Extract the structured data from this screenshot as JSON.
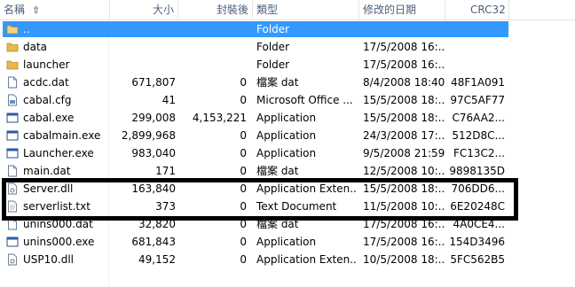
{
  "columns": {
    "name": "名稱",
    "size": "大小",
    "packed": "封裝後",
    "type": "類型",
    "modified": "修改的日期",
    "crc": "CRC32"
  },
  "rows": [
    {
      "name": "..",
      "size": "",
      "packed": "",
      "type": "Folder",
      "date": "",
      "crc": "",
      "icon": "folder-up-icon",
      "selected": true
    },
    {
      "name": "data",
      "size": "",
      "packed": "",
      "type": "Folder",
      "date": "17/5/2008 16:...",
      "crc": "",
      "icon": "folder-icon"
    },
    {
      "name": "launcher",
      "size": "",
      "packed": "",
      "type": "Folder",
      "date": "17/5/2008 16:...",
      "crc": "",
      "icon": "folder-icon"
    },
    {
      "name": "acdc.dat",
      "size": "671,807",
      "packed": "0",
      "type": "檔案 dat",
      "date": "8/4/2008 18:40",
      "crc": "48F1A091",
      "icon": "file-icon"
    },
    {
      "name": "cabal.cfg",
      "size": "41",
      "packed": "0",
      "type": "Microsoft Office ...",
      "date": "15/5/2008 18:...",
      "crc": "97C5AF77",
      "icon": "config-file-icon"
    },
    {
      "name": "cabal.exe",
      "size": "299,008",
      "packed": "4,153,221",
      "type": "Application",
      "date": "15/5/2008 18:...",
      "crc": "C76AA2...",
      "icon": "exe-icon"
    },
    {
      "name": "cabalmain.exe",
      "size": "2,899,968",
      "packed": "0",
      "type": "Application",
      "date": "24/3/2008 17:...",
      "crc": "512D8C...",
      "icon": "exe-icon"
    },
    {
      "name": "Launcher.exe",
      "size": "983,040",
      "packed": "0",
      "type": "Application",
      "date": "9/5/2008 21:59",
      "crc": "FC13C2...",
      "icon": "exe-icon"
    },
    {
      "name": "main.dat",
      "size": "171",
      "packed": "0",
      "type": "檔案 dat",
      "date": "12/5/2008 10:...",
      "crc": "9898135D",
      "icon": "file-icon"
    },
    {
      "name": "Server.dll",
      "size": "163,840",
      "packed": "0",
      "type": "Application Exten...",
      "date": "15/5/2008 18:...",
      "crc": "706DD6...",
      "icon": "dll-icon"
    },
    {
      "name": "serverlist.txt",
      "size": "373",
      "packed": "0",
      "type": "Text Document",
      "date": "11/5/2008 10:...",
      "crc": "6E20248C",
      "icon": "text-file-icon"
    },
    {
      "name": "unins000.dat",
      "size": "32,820",
      "packed": "0",
      "type": "檔案 dat",
      "date": "17/5/2008 16:...",
      "crc": "4A0CE4...",
      "icon": "file-icon"
    },
    {
      "name": "unins000.exe",
      "size": "681,843",
      "packed": "0",
      "type": "Application",
      "date": "17/5/2008 16:...",
      "crc": "154D3496",
      "icon": "exe-icon"
    },
    {
      "name": "USP10.dll",
      "size": "49,152",
      "packed": "0",
      "type": "Application Exten...",
      "date": "10/5/2008 18:...",
      "crc": "5FC562B5",
      "icon": "dll-icon"
    }
  ],
  "colors": {
    "selection": "#3399ff",
    "header_text": "#4c607a",
    "folder": "#e8b84a",
    "highlight_box": "#000000"
  }
}
